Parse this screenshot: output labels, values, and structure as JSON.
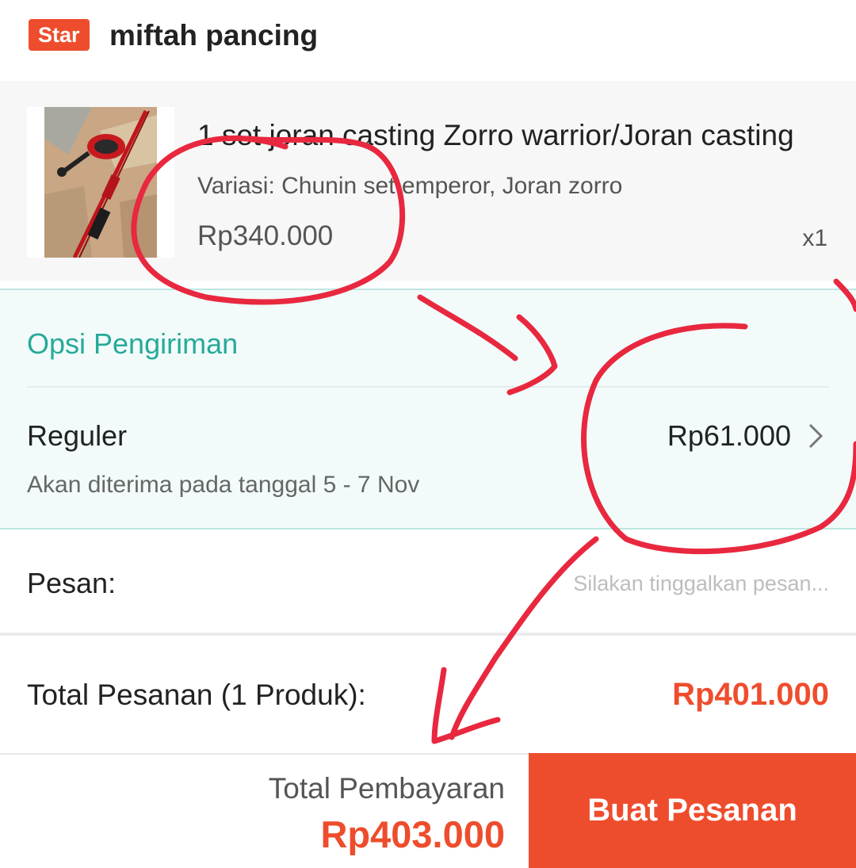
{
  "shop": {
    "badge": "Star",
    "name": "miftah pancing"
  },
  "product": {
    "image_icon": "fishing-rod-reel-photo",
    "title": "1 set joran casting Zorro warrior/Joran casting",
    "variation": "Variasi: Chunin set emperor, Joran zorro",
    "price": "Rp340.000",
    "quantity": "x1"
  },
  "shipping": {
    "section_title": "Opsi Pengiriman",
    "method": "Reguler",
    "price": "Rp61.000",
    "eta": "Akan diterima pada tanggal 5 - 7 Nov",
    "chevron_icon": "chevron-right-icon"
  },
  "message": {
    "label": "Pesan:",
    "placeholder": "Silakan tinggalkan pesan...",
    "value": ""
  },
  "order_total": {
    "label": "Total Pesanan (1 Produk):",
    "value": "Rp401.000"
  },
  "payment": {
    "label": "Total Pembayaran",
    "value": "Rp403.000",
    "button": "Buat Pesanan"
  },
  "colors": {
    "brand": "#ee4d2d",
    "shipping_accent": "#26aa99",
    "shipping_bg": "#f2fbfa",
    "annotation_ink": "#e8283f"
  }
}
